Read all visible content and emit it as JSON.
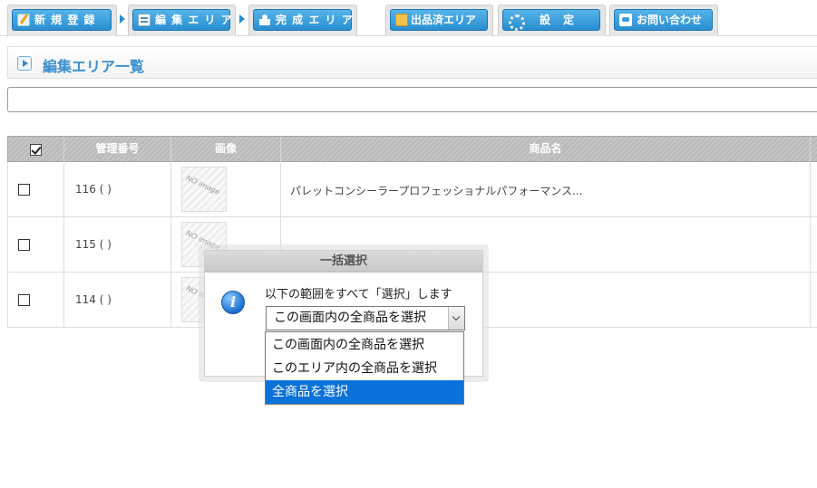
{
  "nav": {
    "tabs": [
      {
        "label": "新 規 登 録",
        "icon": "new-register-icon"
      },
      {
        "label": "編 集 エ リ ア",
        "icon": "edit-area-icon"
      },
      {
        "label": "完 成 エ リ ア",
        "icon": "complete-area-icon"
      },
      {
        "label": "出品済エリア",
        "icon": "listed-area-icon"
      },
      {
        "label": "設　定",
        "icon": "gear-icon"
      },
      {
        "label": "お問い合わせ",
        "icon": "chat-icon"
      }
    ],
    "accent_color": "#2a8ed0"
  },
  "page": {
    "title": "編集エリア一覧"
  },
  "search": {
    "value": ""
  },
  "table": {
    "headers": [
      "管理番号",
      "画像",
      "商品名"
    ],
    "rows": [
      {
        "code": "116 ( )",
        "image": "NO image",
        "name": "パレットコンシーラープロフェッショナルパフォーマンス...",
        "checked": false
      },
      {
        "code": "115 ( )",
        "image": "NO image",
        "name": "",
        "checked": false
      },
      {
        "code": "114 ( )",
        "image": "NO image",
        "name": "",
        "checked": false
      }
    ]
  },
  "modal": {
    "title": "一括選択",
    "message": "以下の範囲をすべて「選択」します",
    "selected": "この画面内の全商品を選択",
    "options": [
      "この画面内の全商品を選択",
      "このエリア内の全商品を選択",
      "全商品を選択"
    ],
    "highlighted_index": 2,
    "highlight_color": "#0a72d8"
  }
}
